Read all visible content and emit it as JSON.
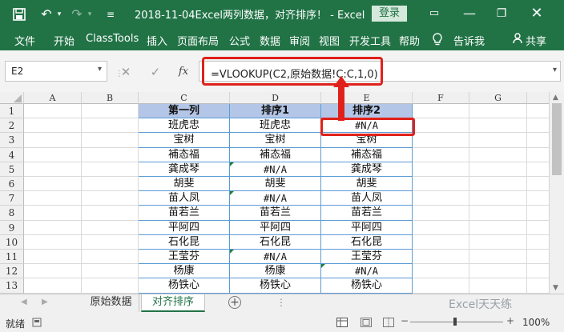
{
  "window": {
    "title": "2018-11-04Excel两列数据，对齐排序！ - Excel",
    "login_label": "登录",
    "share_label": "共享"
  },
  "ribbon": {
    "tabs": [
      "文件",
      "开始",
      "ClassTools",
      "插入",
      "页面布局",
      "公式",
      "数据",
      "审阅",
      "视图",
      "开发工具",
      "帮助"
    ],
    "tell_me": "告诉我"
  },
  "formula_bar": {
    "name_box": "E2",
    "fx_label": "fx",
    "formula": "=VLOOKUP(C2,原始数据!C:C,1,0)"
  },
  "sheet": {
    "columns": [
      "A",
      "B",
      "C",
      "D",
      "E",
      "F",
      "G"
    ],
    "row_numbers": [
      "1",
      "2",
      "3",
      "4",
      "5",
      "6",
      "7",
      "8",
      "9",
      "10",
      "11",
      "12",
      "13"
    ],
    "headers": [
      "第一列",
      "排序1",
      "排序2"
    ],
    "rows": [
      [
        "班虎忠",
        "班虎忠",
        "#N/A"
      ],
      [
        "宝树",
        "宝树",
        "宝树"
      ],
      [
        "補态福",
        "補态福",
        "補态福"
      ],
      [
        "龚成琴",
        "#N/A",
        "龚成琴"
      ],
      [
        "胡斐",
        "胡斐",
        "胡斐"
      ],
      [
        "苗人凤",
        "#N/A",
        "苗人凤"
      ],
      [
        "苗若兰",
        "苗若兰",
        "苗若兰"
      ],
      [
        "平阿四",
        "平阿四",
        "平阿四"
      ],
      [
        "石化昆",
        "石化昆",
        "石化昆"
      ],
      [
        "王莹芬",
        "#N/A",
        "王莹芬"
      ],
      [
        "杨康",
        "杨康",
        "#N/A"
      ],
      [
        "杨铁心",
        "杨铁心",
        "杨铁心"
      ]
    ]
  },
  "sheet_tabs": [
    "原始数据",
    "对齐排序"
  ],
  "active_tab": "对齐排序",
  "watermark": "Excel天天练",
  "status": {
    "ready": "就绪",
    "zoom": "100%"
  },
  "colors": {
    "excel_green": "#217346",
    "table_header_fill": "#b4c6e7",
    "highlight_red": "#e0211b"
  }
}
